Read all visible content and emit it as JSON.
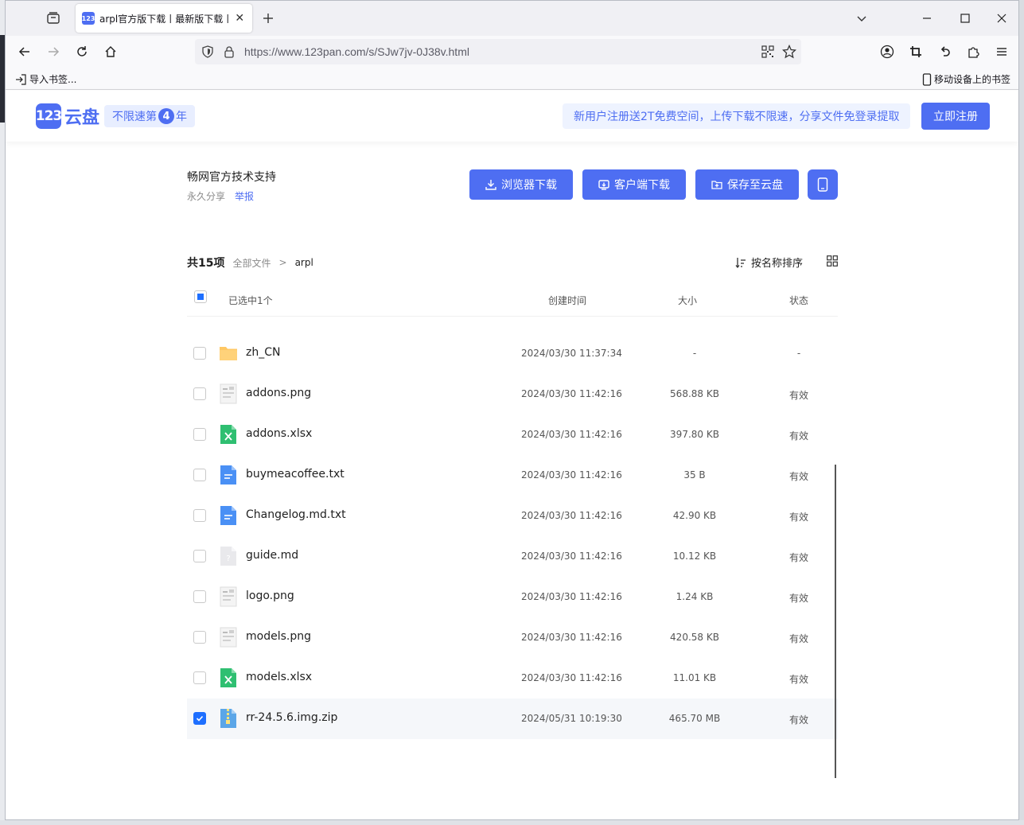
{
  "browser": {
    "tab_title": "arpl官方版下载丨最新版下载丨",
    "url": "https://www.123pan.com/s/SJw7jv-0J38v.html",
    "bookmark_import": "导入书签...",
    "bookmark_mobile": "移动设备上的书签"
  },
  "site": {
    "logo_mark": "123",
    "logo_text": "云盘",
    "badge_pre": "不限速第",
    "badge_num": "4",
    "badge_post": "年",
    "promo": "新用户注册送2T免费空间，上传下载不限速，分享文件免登录提取",
    "register": "立即注册"
  },
  "share": {
    "owner": "畅网官方技术支持",
    "permanence": "永久分享",
    "report": "举报",
    "btn_browser_download": "浏览器下载",
    "btn_client_download": "客户端下载",
    "btn_save": "保存至云盘"
  },
  "listing": {
    "count": "共15项",
    "crumb_root": "全部文件",
    "crumb_sep": ">",
    "crumb_current": "arpl",
    "sort_label": "按名称排序",
    "selected_label": "已选中1个",
    "col_time": "创建时间",
    "col_size": "大小",
    "col_status": "状态"
  },
  "files": [
    {
      "name": "zh_CN",
      "time": "2024/03/30 11:37:34",
      "size": "-",
      "status": "-",
      "type": "folder-icon",
      "checked": false
    },
    {
      "name": "addons.png",
      "time": "2024/03/30 11:42:16",
      "size": "568.88 KB",
      "status": "有效",
      "type": "image-file-icon",
      "checked": false
    },
    {
      "name": "addons.xlsx",
      "time": "2024/03/30 11:42:16",
      "size": "397.80 KB",
      "status": "有效",
      "type": "excel-file-icon",
      "checked": false
    },
    {
      "name": "buymeacoffee.txt",
      "time": "2024/03/30 11:42:16",
      "size": "35 B",
      "status": "有效",
      "type": "text-file-icon",
      "checked": false
    },
    {
      "name": "Changelog.md.txt",
      "time": "2024/03/30 11:42:16",
      "size": "42.90 KB",
      "status": "有效",
      "type": "text-file-icon",
      "checked": false
    },
    {
      "name": "guide.md",
      "time": "2024/03/30 11:42:16",
      "size": "10.12 KB",
      "status": "有效",
      "type": "unknown-file-icon",
      "checked": false
    },
    {
      "name": "logo.png",
      "time": "2024/03/30 11:42:16",
      "size": "1.24 KB",
      "status": "有效",
      "type": "image-file-icon",
      "checked": false
    },
    {
      "name": "models.png",
      "time": "2024/03/30 11:42:16",
      "size": "420.58 KB",
      "status": "有效",
      "type": "image-file-icon",
      "checked": false
    },
    {
      "name": "models.xlsx",
      "time": "2024/03/30 11:42:16",
      "size": "11.01 KB",
      "status": "有效",
      "type": "excel-file-icon",
      "checked": false
    },
    {
      "name": "rr-24.5.6.img.zip",
      "time": "2024/05/31 10:19:30",
      "size": "465.70 MB",
      "status": "有效",
      "type": "zip-file-icon",
      "checked": true
    }
  ],
  "colors": {
    "brand": "#4e6ef2",
    "checkbox_active": "#1e6fff",
    "folder": "#ffc864",
    "excel": "#2fbf71",
    "text_file": "#4a90f5"
  }
}
